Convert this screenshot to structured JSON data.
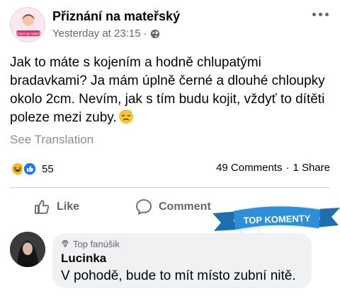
{
  "post": {
    "page_name": "Přiznání na mateřský",
    "timestamp": "Yesterday at 23:15",
    "separator": "·",
    "text": "Jak to máte s kojením a hodně chlupatými bradavkami? Ja mám úplně černé a dlouhé chloupky okolo 2cm. Nevím, jak s tím budu kojit, vždyť to dítěti poleze mezi zuby.",
    "see_translation": "See Translation",
    "avatar_text": "Přiznání na mateřský"
  },
  "stats": {
    "reaction_count": "55",
    "reactions": [
      "haha-icon",
      "like-icon"
    ],
    "comments": "49 Comments",
    "dot": "·",
    "shares": "1 Share"
  },
  "actions": {
    "like_label": "Like",
    "comment_label": "Comment"
  },
  "banner": {
    "label": "TOP KOMENTY"
  },
  "top_comment": {
    "badge": "Top fanúšik",
    "name": "Lucinka",
    "text": "V pohodě, bude to mít místo zubní nitě."
  },
  "colors": {
    "banner_blue": "#2c8fd8",
    "meta_grey": "#65676b",
    "like_blue": "#1877f2",
    "haha_yellow": "#f7b928"
  }
}
